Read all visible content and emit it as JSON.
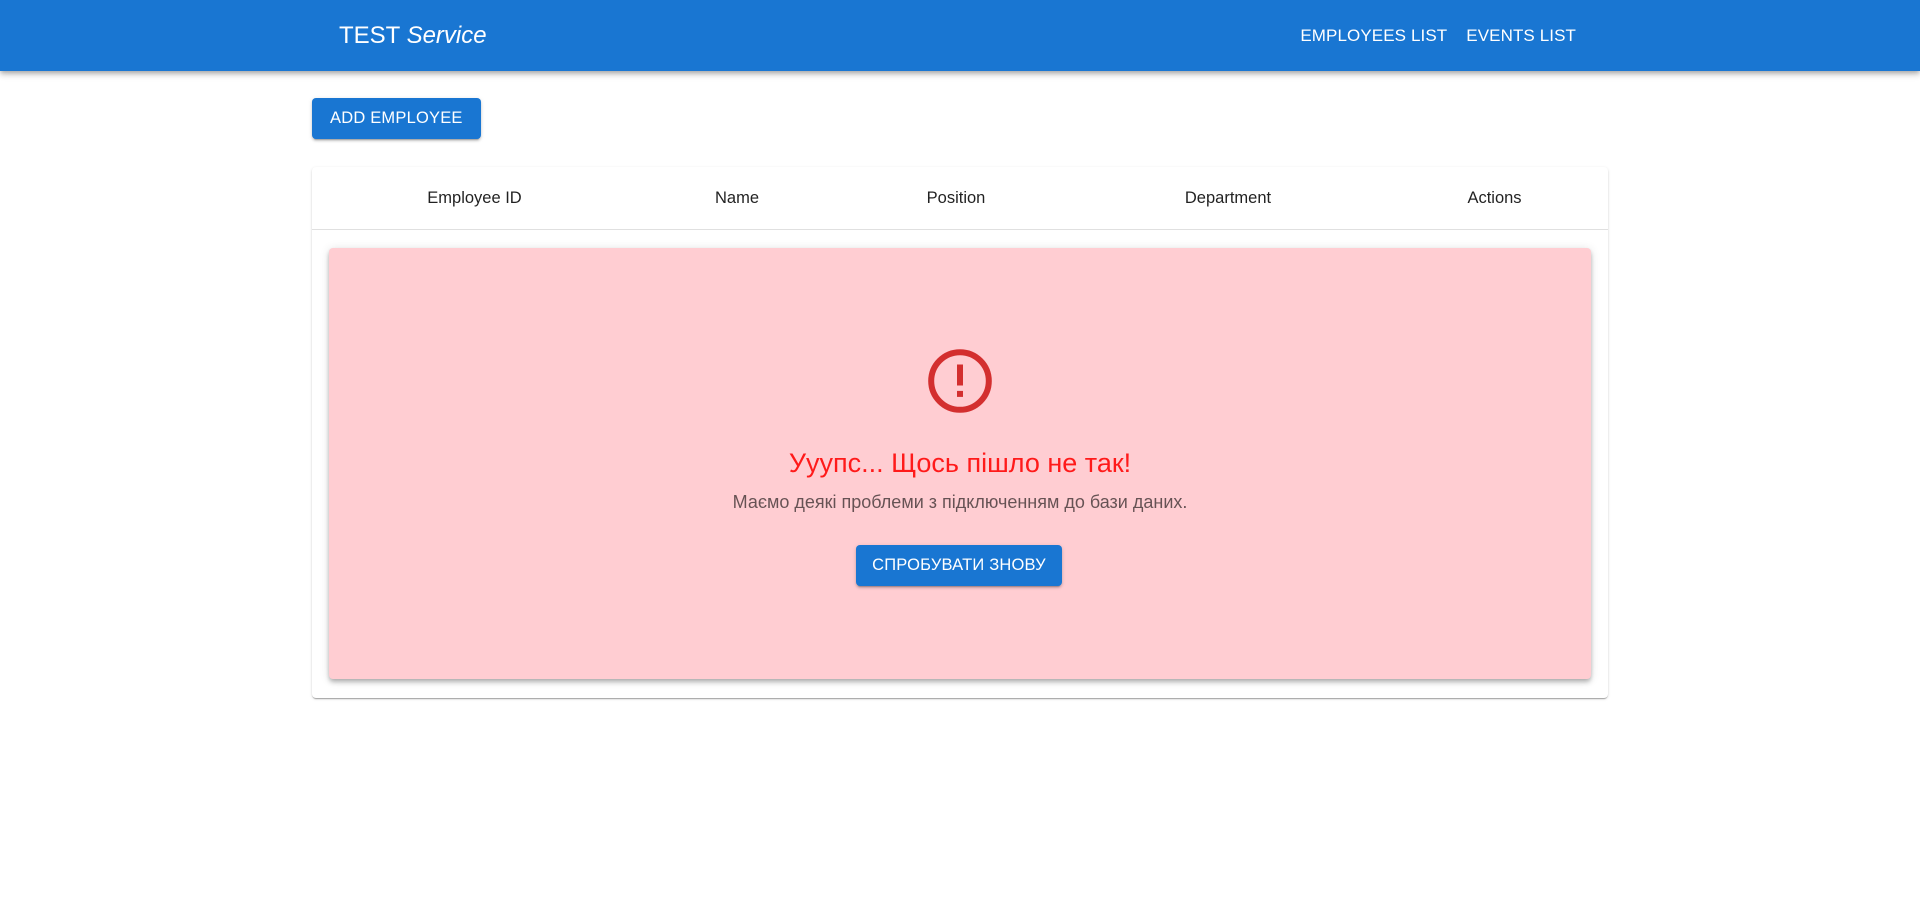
{
  "header": {
    "brand_main": "TEST",
    "brand_italic": "Service",
    "nav": [
      {
        "label": "EMPLOYEES LIST"
      },
      {
        "label": "EVENTS LIST"
      }
    ]
  },
  "toolbar": {
    "add_label": "ADD EMPLOYEE"
  },
  "table": {
    "columns": [
      "Employee ID",
      "Name",
      "Position",
      "Department",
      "Actions"
    ]
  },
  "error": {
    "icon": "error-outline-icon",
    "title": "Ууупс... Щось пішло не так!",
    "message": "Маємо деякі проблеми з підключенням до бази даних.",
    "retry_label": "СПРОБУВАТИ ЗНОВУ"
  },
  "colors": {
    "primary": "#1976d2",
    "error_bg": "#ffcdd2",
    "error_icon": "#d32f2f",
    "error_title": "#ff1a1a"
  }
}
